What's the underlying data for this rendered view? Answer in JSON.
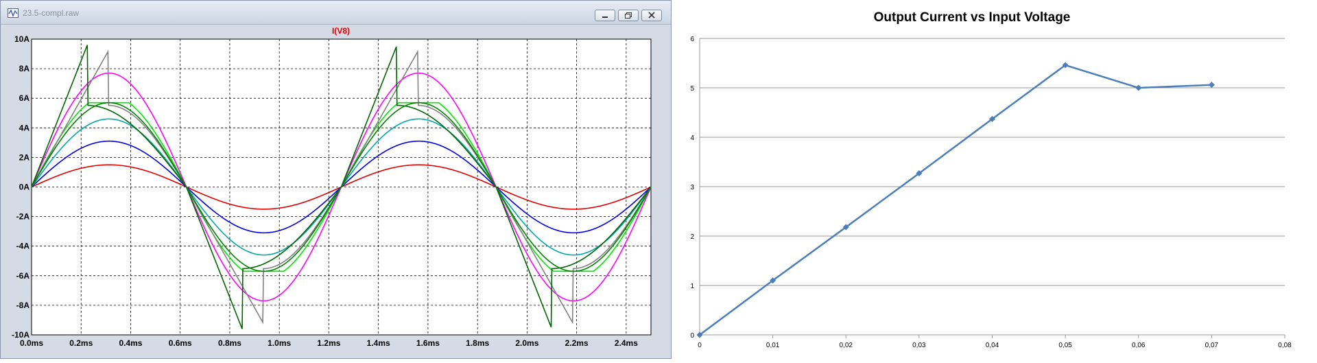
{
  "window": {
    "title": "23.5-compl.raw"
  },
  "chart_data": [
    {
      "type": "line",
      "title": "I(V8)",
      "xlabel": "",
      "ylabel": "",
      "xlim": [
        0,
        2.5
      ],
      "ylim": [
        -10,
        10
      ],
      "x_ticks": [
        "0.0ms",
        "0.2ms",
        "0.4ms",
        "0.6ms",
        "0.8ms",
        "1.0ms",
        "1.2ms",
        "1.4ms",
        "1.6ms",
        "1.8ms",
        "2.0ms",
        "2.2ms",
        "2.4ms"
      ],
      "y_ticks": [
        "10A",
        "8A",
        "6A",
        "4A",
        "2A",
        "0A",
        "-2A",
        "-4A",
        "-6A",
        "-8A",
        "-10A"
      ],
      "grid": true,
      "period_ms": 1.25,
      "series": [
        {
          "color": "#e00000",
          "amplitude": 1.5
        },
        {
          "color": "#0000e6",
          "amplitude": 3.1
        },
        {
          "color": "#00a8a8",
          "amplitude": 4.6
        },
        {
          "color": "#00e600",
          "amplitude": 6.2,
          "clip": 5.7
        },
        {
          "color": "#ff00ff",
          "amplitude": 7.7
        },
        {
          "color": "#808080",
          "amplitude": 9.2,
          "clip": 9.2,
          "drop_to": 2.3,
          "drop_at_ms": 0.31
        },
        {
          "color": "#006400",
          "amplitude": 9.6,
          "clip": 9.6,
          "drop_to": 2.3,
          "drop_at_ms": 0.225
        },
        {
          "color": "#008000",
          "amplitude": 5.7,
          "clip": 5.75
        }
      ]
    },
    {
      "type": "line",
      "title": "Output Current vs Input Voltage",
      "xlabel": "",
      "ylabel": "",
      "xlim": [
        0,
        0.08
      ],
      "ylim": [
        0,
        6
      ],
      "x_ticks": [
        "0",
        "0,01",
        "0,02",
        "0,03",
        "0,04",
        "0,05",
        "0,06",
        "0,07",
        "0,08"
      ],
      "y_ticks": [
        "0",
        "1",
        "2",
        "3",
        "4",
        "5",
        "6"
      ],
      "grid": true,
      "color": "#4a7ebb",
      "x": [
        0,
        0.01,
        0.02,
        0.03,
        0.04,
        0.05,
        0.06,
        0.07
      ],
      "values": [
        0,
        1.1,
        2.18,
        3.27,
        4.37,
        5.46,
        5.0,
        5.06
      ]
    }
  ]
}
